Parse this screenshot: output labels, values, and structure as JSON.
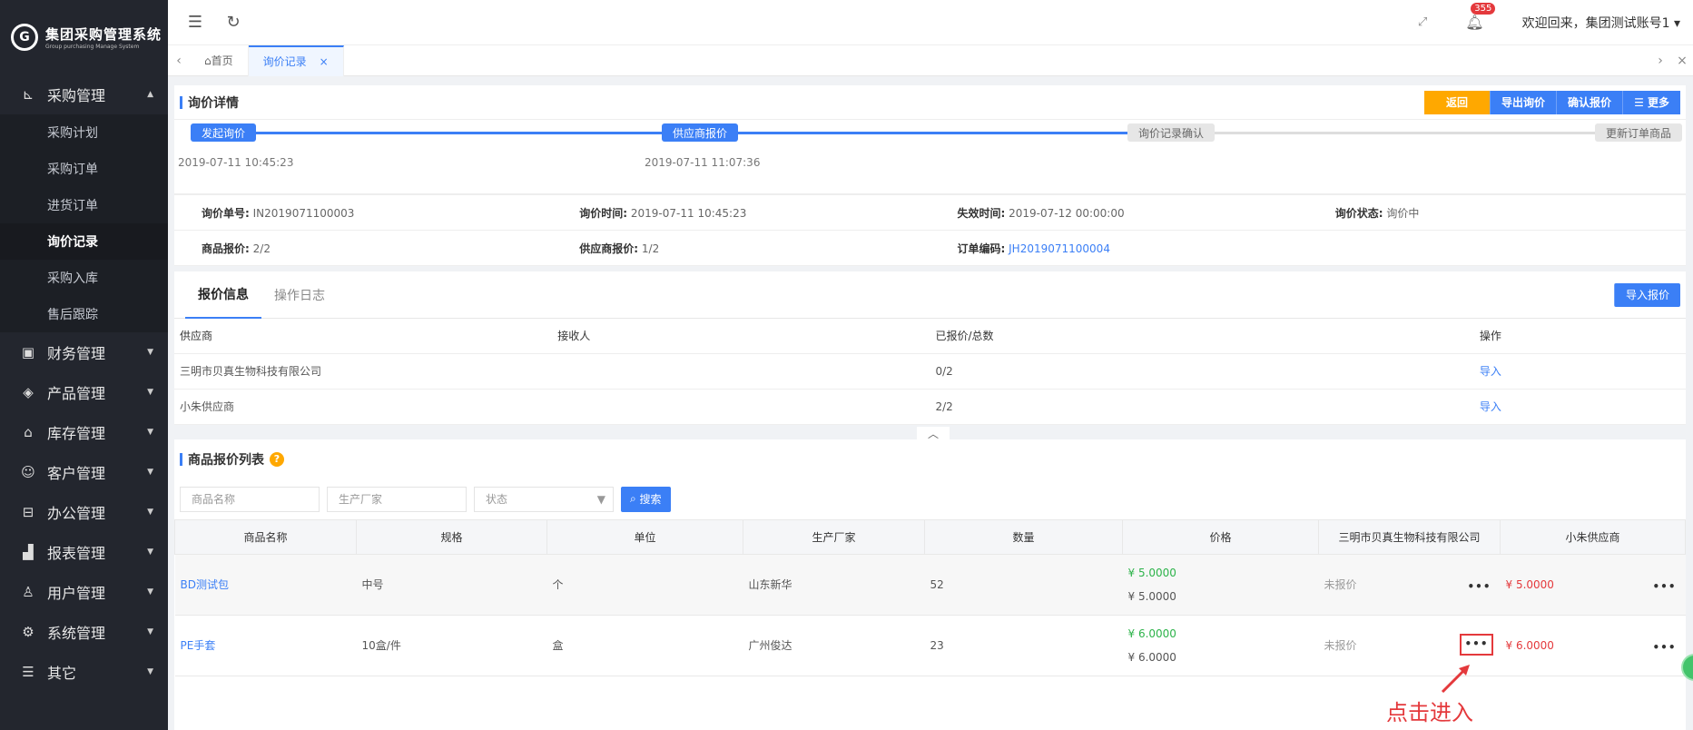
{
  "app": {
    "logo_letter": "G",
    "title": "集团采购管理系统",
    "subtitle": "Group purchasing Manage System"
  },
  "sidebar": {
    "groups": [
      {
        "label": "采购管理",
        "icon": "cart-icon",
        "glyph": "⊾"
      },
      {
        "label": "财务管理",
        "icon": "finance-icon",
        "glyph": "▣"
      },
      {
        "label": "产品管理",
        "icon": "product-icon",
        "glyph": "◈"
      },
      {
        "label": "库存管理",
        "icon": "warehouse-icon",
        "glyph": "⌂"
      },
      {
        "label": "客户管理",
        "icon": "customer-icon",
        "glyph": "☺"
      },
      {
        "label": "办公管理",
        "icon": "office-icon",
        "glyph": "⊟"
      },
      {
        "label": "报表管理",
        "icon": "report-icon",
        "glyph": "▟"
      },
      {
        "label": "用户管理",
        "icon": "user-icon",
        "glyph": "♙"
      },
      {
        "label": "系统管理",
        "icon": "settings-icon",
        "glyph": "⚙"
      },
      {
        "label": "其它",
        "icon": "other-icon",
        "glyph": "☰"
      }
    ],
    "subitems": [
      "采购计划",
      "采购订单",
      "进货订单",
      "询价记录",
      "采购入库",
      "售后跟踪"
    ]
  },
  "topbar": {
    "badge": "355",
    "welcome": "欢迎回来，集团测试账号1 ▾"
  },
  "tabs": {
    "home": "⌂首页",
    "current": "询价记录",
    "close": "×"
  },
  "detail": {
    "title": "询价详情",
    "buttons": {
      "back": "返回",
      "export": "导出询价",
      "confirm": "确认报价",
      "more": "☰ 更多"
    },
    "steps": [
      {
        "label": "发起询价",
        "time": "2019-07-11 10:45:23"
      },
      {
        "label": "供应商报价",
        "time": "2019-07-11 11:07:36"
      },
      {
        "label": "询价记录确认",
        "time": ""
      },
      {
        "label": "更新订单商品",
        "time": ""
      }
    ],
    "info": {
      "no_label": "询价单号:",
      "no": "IN2019071100003",
      "time_label": "询价时间:",
      "time": "2019-07-11 10:45:23",
      "expire_label": "失效时间:",
      "expire": "2019-07-12 00:00:00",
      "status_label": "询价状态:",
      "status": "询价中",
      "goods_label": "商品报价:",
      "goods": "2/2",
      "supplier_label": "供应商报价:",
      "supplier": "1/2",
      "order_label": "订单编码:",
      "order": "JH2019071100004"
    }
  },
  "quote_tabs": {
    "info": "报价信息",
    "log": "操作日志",
    "import_btn": "导入报价"
  },
  "supplier_table": {
    "headers": [
      "供应商",
      "接收人",
      "已报价/总数",
      "操作"
    ],
    "rows": [
      {
        "supplier": "三明市贝真生物科技有限公司",
        "receiver": "",
        "ratio": "0/2",
        "action": "导入"
      },
      {
        "supplier": "小朱供应商",
        "receiver": "",
        "ratio": "2/2",
        "action": "导入"
      }
    ]
  },
  "goods": {
    "title": "商品报价列表",
    "filters": {
      "name": "商品名称",
      "maker": "生产厂家",
      "status": "状态",
      "search": "搜索"
    },
    "headers": [
      "商品名称",
      "规格",
      "单位",
      "生产厂家",
      "数量",
      "价格",
      "三明市贝真生物科技有限公司",
      "小朱供应商"
    ],
    "rows": [
      {
        "name": "BD测试包",
        "spec": "中号",
        "unit": "个",
        "maker": "山东新华",
        "qty": "52",
        "price1": "¥ 5.0000",
        "price2": "¥ 5.0000",
        "s1": "未报价",
        "s2": "¥ 5.0000"
      },
      {
        "name": "PE手套",
        "spec": "10盒/件",
        "unit": "盒",
        "maker": "广州俊达",
        "qty": "23",
        "price1": "¥ 6.0000",
        "price2": "¥ 6.0000",
        "s1": "未报价",
        "s2": "¥ 6.0000"
      }
    ]
  },
  "annotation": "点击进入",
  "colors": {
    "primary": "#3b7ff6",
    "orange": "#ffa800",
    "sidebar": "#23262e",
    "red": "#e4393c",
    "green": "#2db34a"
  }
}
